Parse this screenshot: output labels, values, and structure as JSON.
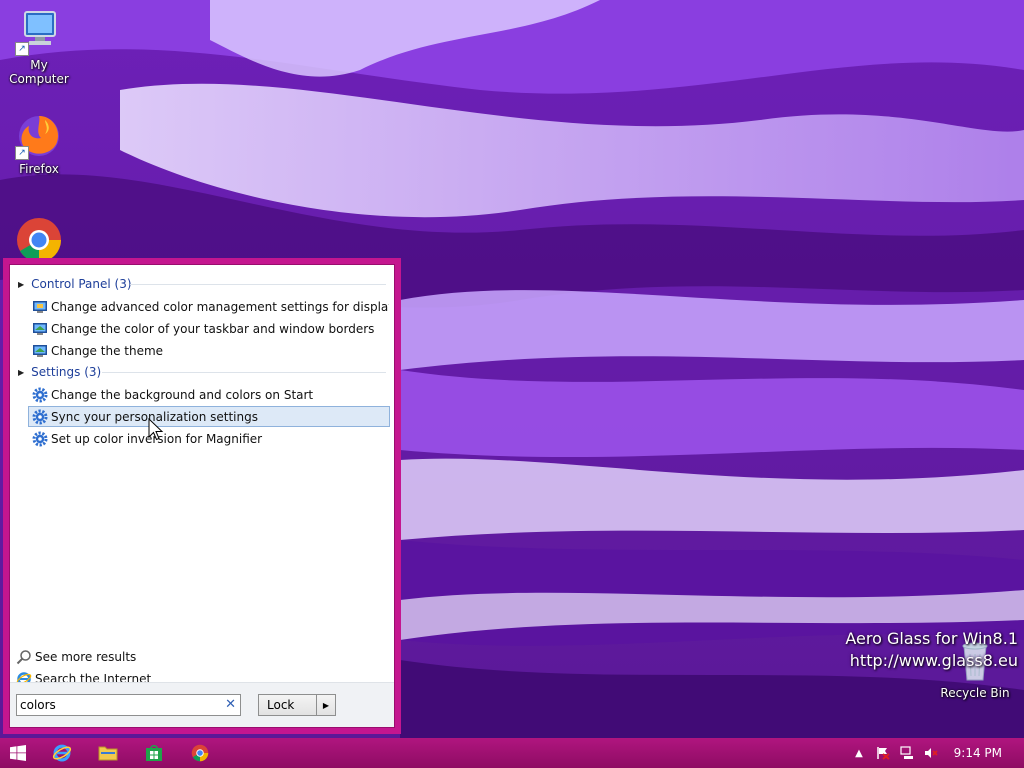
{
  "desktop": {
    "icons": [
      {
        "label": "My Computer",
        "icon": "computer-icon"
      },
      {
        "label": "Firefox",
        "icon": "firefox-icon"
      },
      {
        "label": "",
        "icon": "chrome-icon"
      },
      {
        "label": "Recycle Bin",
        "icon": "recycle-bin-icon"
      }
    ],
    "watermark": {
      "line1": "Aero Glass for Win8.1",
      "line2": "http://www.glass8.eu"
    }
  },
  "start_menu": {
    "groups": [
      {
        "header": "Control Panel (3)",
        "items": [
          {
            "label": "Change advanced color management settings for displays, sca...",
            "icon": "control-panel-display-icon"
          },
          {
            "label": "Change the color of your taskbar and window borders",
            "icon": "control-panel-display-icon"
          },
          {
            "label": "Change the theme",
            "icon": "control-panel-display-icon"
          }
        ]
      },
      {
        "header": "Settings (3)",
        "items": [
          {
            "label": "Change the background and colors on Start",
            "icon": "gear-icon"
          },
          {
            "label": "Sync your personalization settings",
            "icon": "gear-icon",
            "selected": true
          },
          {
            "label": "Set up color inversion for Magnifier",
            "icon": "gear-icon"
          }
        ]
      }
    ],
    "see_more": "See more results",
    "search_internet": "Search the Internet",
    "search_value": "colors",
    "lock_label": "Lock"
  },
  "taskbar": {
    "pinned": [
      "start-icon",
      "internet-explorer-icon",
      "file-explorer-icon",
      "store-icon",
      "chrome-icon"
    ],
    "clock": "9:14 PM"
  },
  "colors": {
    "menu_border": "#c4168f",
    "taskbar": "#a0127a",
    "selection": "#dde9f7"
  }
}
